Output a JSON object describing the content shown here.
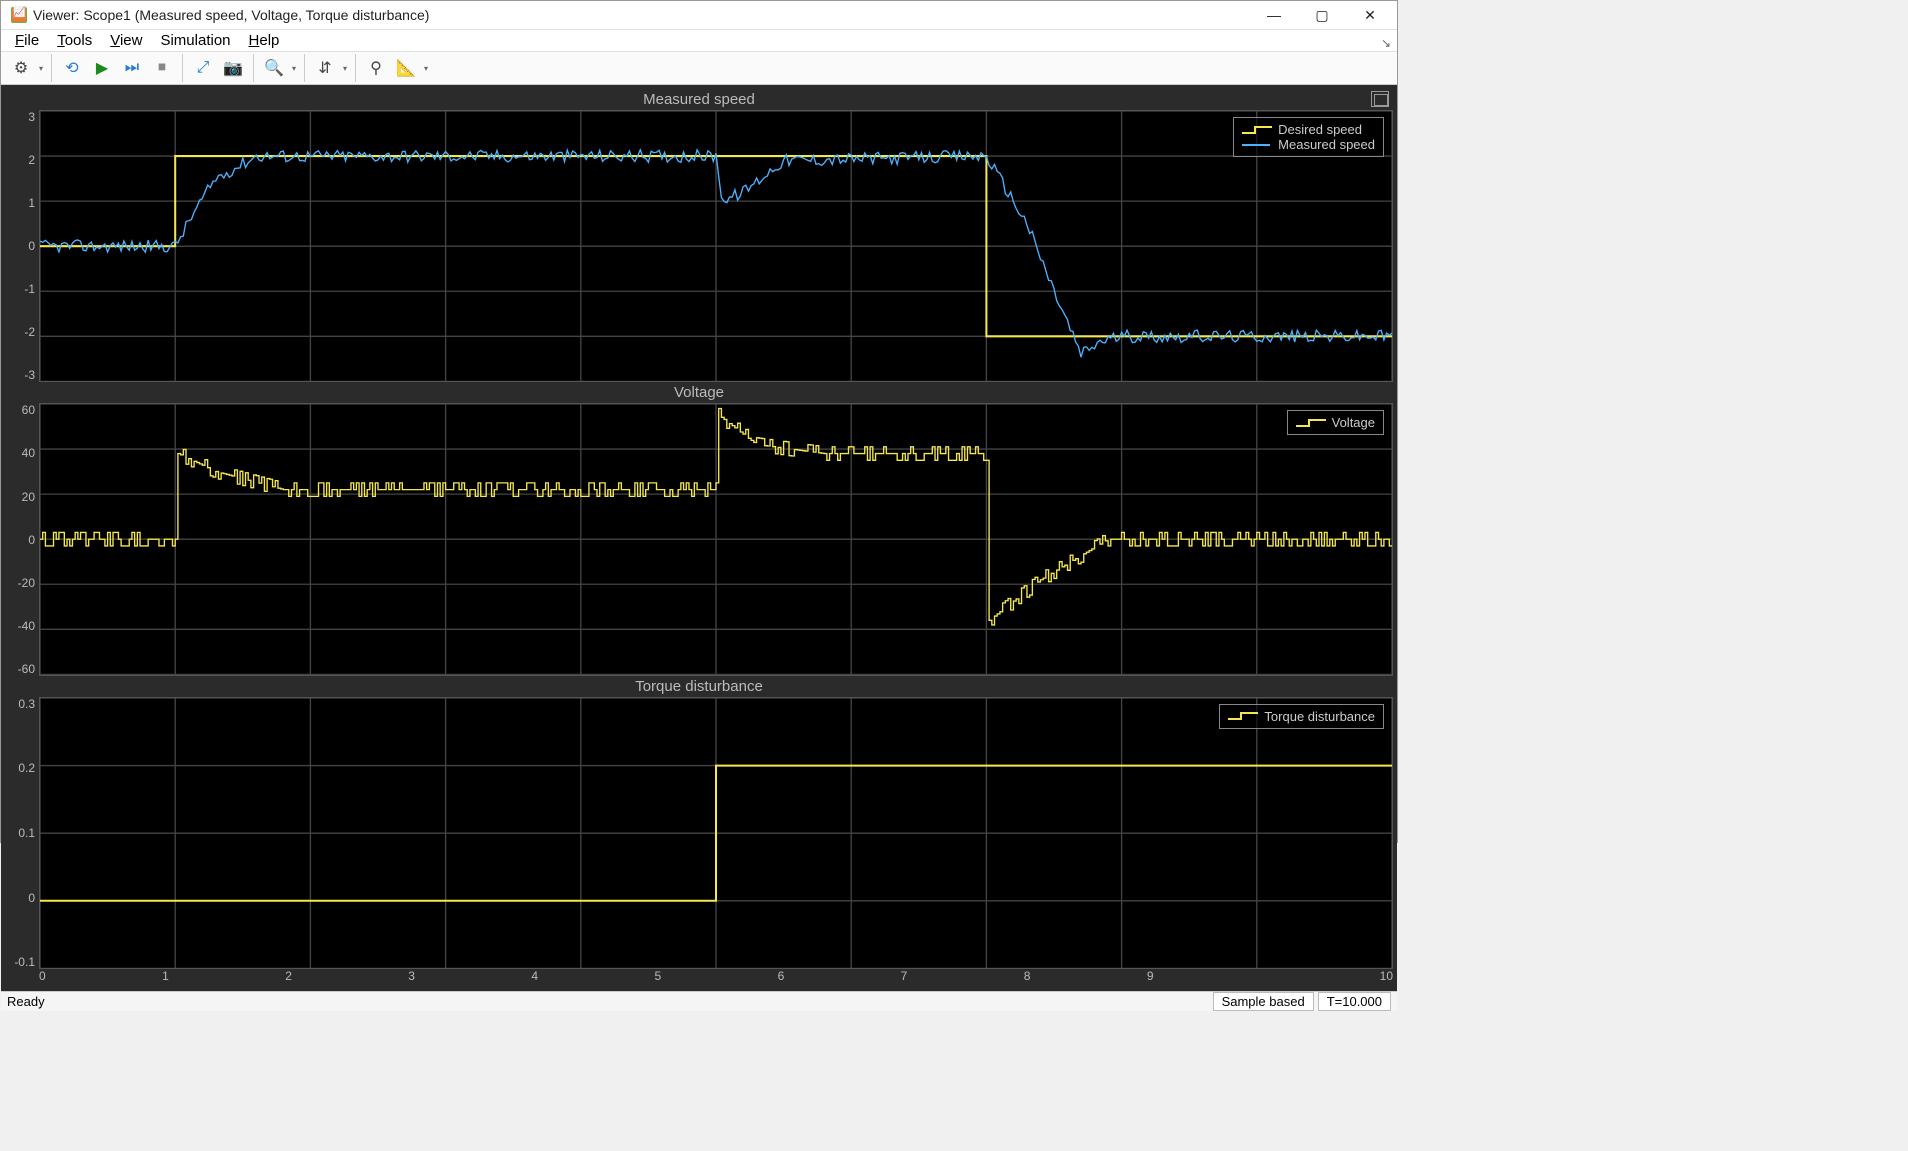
{
  "window": {
    "title": "Viewer: Scope1 (Measured speed, Voltage, Torque disturbance)"
  },
  "menu": {
    "file": "File",
    "tools": "Tools",
    "view": "View",
    "simulation": "Simulation",
    "help": "Help"
  },
  "status": {
    "ready": "Ready",
    "sample": "Sample based",
    "time": "T=10.000"
  },
  "chart_data": [
    {
      "type": "line",
      "title": "Measured speed",
      "xlim": [
        0,
        10
      ],
      "ylim": [
        -3,
        3
      ],
      "yticks": [
        3,
        2,
        1,
        0,
        -1,
        -2,
        -3
      ],
      "legend": [
        "Desired  speed",
        "Measured speed"
      ],
      "series": [
        {
          "name": "Desired  speed",
          "kind": "step",
          "color": "#f5e750",
          "x": [
            0,
            1,
            1,
            7,
            7,
            10
          ],
          "y": [
            0,
            0,
            2,
            2,
            -2,
            -2
          ]
        },
        {
          "name": "Measured speed",
          "kind": "noisy",
          "color": "#4db1ff",
          "baseline": [
            [
              0,
              0
            ],
            [
              1,
              0
            ],
            [
              1.15,
              0.8
            ],
            [
              1.3,
              1.5
            ],
            [
              1.6,
              2.0
            ],
            [
              5,
              2.0
            ],
            [
              5.05,
              1.0
            ],
            [
              5.2,
              1.2
            ],
            [
              5.5,
              1.9
            ],
            [
              7,
              2.0
            ],
            [
              7.1,
              1.5
            ],
            [
              7.3,
              0.5
            ],
            [
              7.5,
              -1.0
            ],
            [
              7.7,
              -2.4
            ],
            [
              7.85,
              -2.1
            ],
            [
              8,
              -2.0
            ],
            [
              10,
              -2.0
            ]
          ],
          "noise": 0.28
        }
      ]
    },
    {
      "type": "line",
      "title": "Voltage",
      "xlim": [
        0,
        10
      ],
      "ylim": [
        -60,
        60
      ],
      "yticks": [
        60,
        40,
        20,
        0,
        -20,
        -40,
        -60
      ],
      "legend": [
        "Voltage"
      ],
      "series": [
        {
          "name": "Voltage",
          "kind": "noisy-step",
          "color": "#f5e750",
          "baseline": [
            [
              0,
              0
            ],
            [
              1,
              0
            ],
            [
              1.02,
              38
            ],
            [
              1.3,
              30
            ],
            [
              1.8,
              22
            ],
            [
              5,
              22
            ],
            [
              5.02,
              55
            ],
            [
              5.3,
              42
            ],
            [
              5.8,
              38
            ],
            [
              7,
              38
            ],
            [
              7.02,
              -36
            ],
            [
              7.4,
              -18
            ],
            [
              7.9,
              0
            ],
            [
              10,
              0
            ]
          ],
          "noise": 6
        }
      ]
    },
    {
      "type": "line",
      "title": "Torque disturbance",
      "xlim": [
        0,
        10
      ],
      "ylim": [
        -0.1,
        0.3
      ],
      "yticks": [
        0.3,
        0.2,
        0.1,
        0,
        -0.1
      ],
      "legend": [
        "Torque disturbance"
      ],
      "series": [
        {
          "name": "Torque disturbance",
          "kind": "step",
          "color": "#f5e750",
          "x": [
            0,
            5,
            5,
            10
          ],
          "y": [
            0,
            0,
            0.2,
            0.2
          ]
        }
      ]
    }
  ],
  "xticks": [
    0,
    1,
    2,
    3,
    4,
    5,
    6,
    7,
    8,
    9,
    10
  ]
}
